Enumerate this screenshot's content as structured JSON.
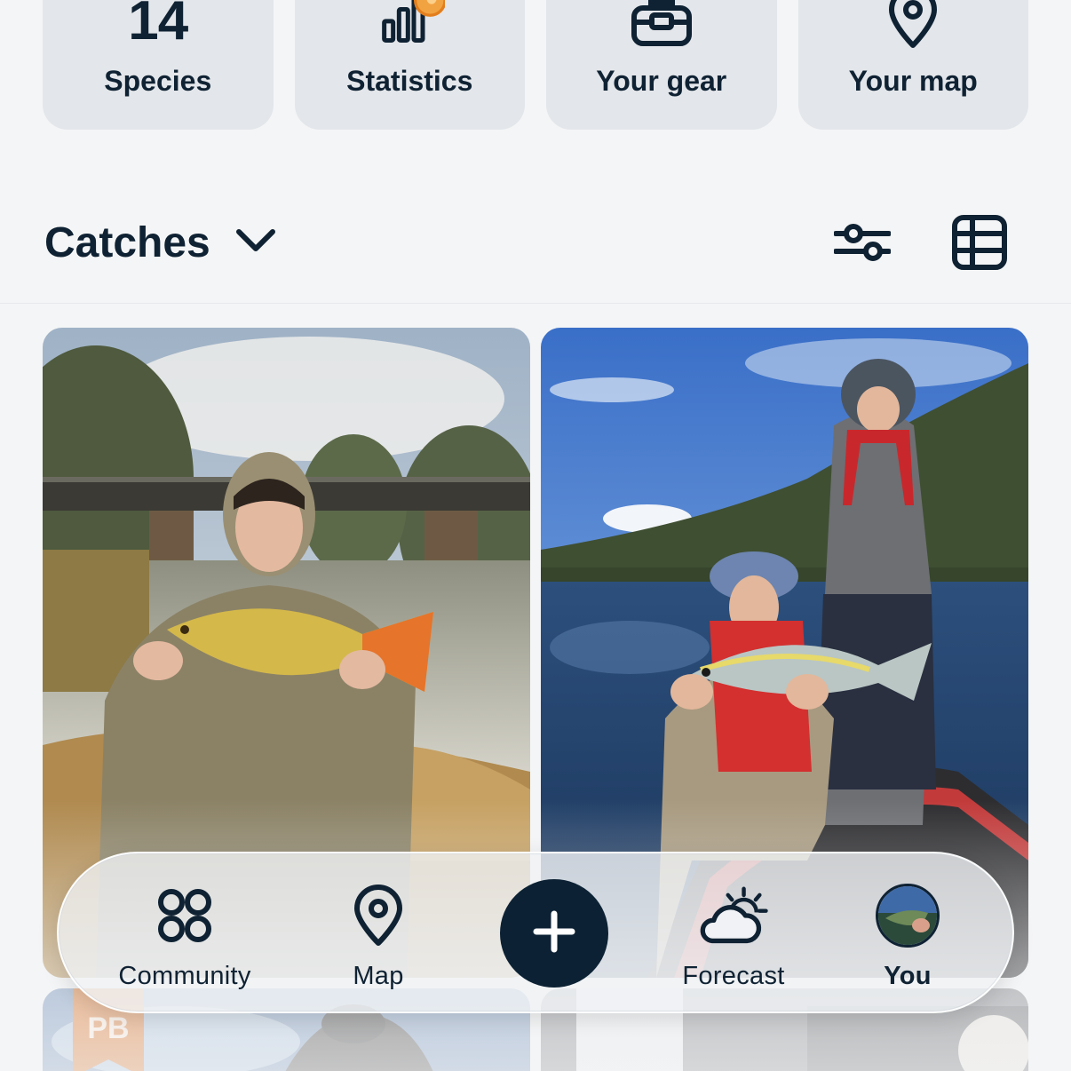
{
  "tiles": [
    {
      "value": "14",
      "label": "Species",
      "icon": "number"
    },
    {
      "label": "Statistics",
      "icon": "bar-chart-icon"
    },
    {
      "label": "Your gear",
      "icon": "tackle-box-icon"
    },
    {
      "label": "Your map",
      "icon": "map-pin-icon"
    }
  ],
  "catches": {
    "title": "Catches",
    "filter_icon": "sliders-icon",
    "view_icon": "table-grid-icon"
  },
  "photos": [
    {
      "description": "boy-holding-carp-by-river"
    },
    {
      "description": "boys-on-boat-holding-fish"
    }
  ],
  "badges": {
    "pb": "PB"
  },
  "nav": {
    "community": "Community",
    "map": "Map",
    "add": "+",
    "forecast": "Forecast",
    "you": "You"
  },
  "colors": {
    "brand_dark": "#0c2234",
    "tile_bg": "#e3e6ea",
    "accent_orange": "#f2a341",
    "pb_orange": "#d96a1a"
  }
}
